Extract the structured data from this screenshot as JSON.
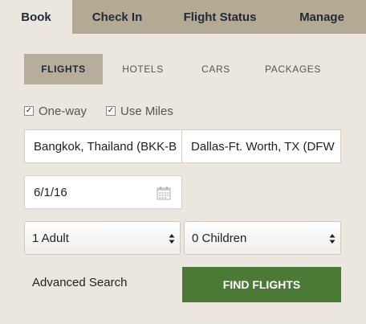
{
  "nav": {
    "tabs": [
      {
        "label": "Book",
        "active": true
      },
      {
        "label": "Check In",
        "active": false
      },
      {
        "label": "Flight Status",
        "active": false
      },
      {
        "label": "Manage",
        "active": false
      }
    ]
  },
  "booking": {
    "sub_tabs": [
      {
        "label": "FLIGHTS",
        "active": true
      },
      {
        "label": "HOTELS",
        "active": false
      },
      {
        "label": "CARS",
        "active": false
      },
      {
        "label": "PACKAGES",
        "active": false
      }
    ],
    "options": {
      "one_way": {
        "label": "One-way",
        "checked": true
      },
      "use_miles": {
        "label": "Use Miles",
        "checked": true
      }
    },
    "origin": {
      "value": "Bangkok, Thailand (BKK-B"
    },
    "destination": {
      "value": "Dallas-Ft. Worth, TX (DFW"
    },
    "date": {
      "value": "6/1/16",
      "icon": "calendar-icon"
    },
    "passengers": {
      "adults": {
        "selected": "1 Adult"
      },
      "children": {
        "selected": "0 Children"
      }
    },
    "advanced_search_label": "Advanced Search",
    "find_flights_label": "FIND FLIGHTS"
  },
  "colors": {
    "page_bg": "#ebe6de",
    "tab_bar_bg": "#b4aa94",
    "sub_tab_active_bg": "#b6ae9b",
    "primary_button": "#4a7a36",
    "tab_text": "#1f2a3a"
  }
}
